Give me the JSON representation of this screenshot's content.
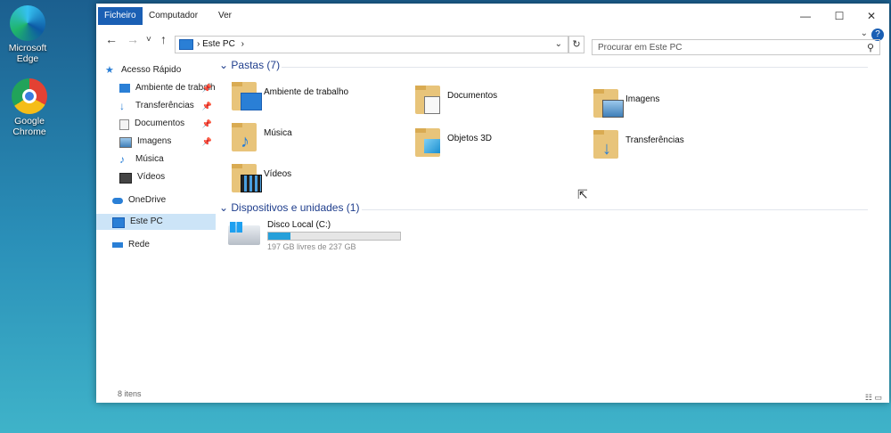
{
  "desktop": {
    "icons": [
      {
        "label": "Microsoft Edge"
      },
      {
        "label": "Google Chrome"
      }
    ]
  },
  "ribbon": {
    "tabs": [
      "Ficheiro",
      "Computador",
      "Ver"
    ]
  },
  "window_controls": {
    "minimize": "—",
    "maximize": "☐",
    "close": "✕"
  },
  "nav": {
    "back": "←",
    "forward": "→",
    "recent": "˅",
    "up": "↑",
    "address": "Este PC",
    "address_sep": "›",
    "refresh": "↻",
    "search_placeholder": "Procurar em Este PC"
  },
  "sidebar": {
    "items": [
      {
        "label": "Acesso Rápido",
        "icon": "star-icon",
        "pinned": false
      },
      {
        "label": "Ambiente de trabalho",
        "icon": "desktop-icon",
        "pinned": true
      },
      {
        "label": "Transferências",
        "icon": "download-icon",
        "pinned": true
      },
      {
        "label": "Documentos",
        "icon": "document-icon",
        "pinned": true
      },
      {
        "label": "Imagens",
        "icon": "picture-icon",
        "pinned": true
      },
      {
        "label": "Música",
        "icon": "music-icon",
        "pinned": false
      },
      {
        "label": "Vídeos",
        "icon": "video-icon",
        "pinned": false
      },
      {
        "label": "OneDrive",
        "icon": "cloud-icon",
        "pinned": false
      },
      {
        "label": "Este PC",
        "icon": "pc-icon",
        "pinned": false
      },
      {
        "label": "Rede",
        "icon": "network-icon",
        "pinned": false
      }
    ]
  },
  "content": {
    "folders_header": "Pastas (7)",
    "folders": [
      {
        "label": "Ambiente de trabalho",
        "icon": "desktop-folder-icon"
      },
      {
        "label": "Documentos",
        "icon": "documents-folder-icon"
      },
      {
        "label": "Imagens",
        "icon": "pictures-folder-icon"
      },
      {
        "label": "Música",
        "icon": "music-folder-icon"
      },
      {
        "label": "Objetos 3D",
        "icon": "3d-objects-folder-icon"
      },
      {
        "label": "Transferências",
        "icon": "downloads-folder-icon"
      },
      {
        "label": "Vídeos",
        "icon": "videos-folder-icon"
      }
    ],
    "devices_header": "Dispositivos e unidades (1)",
    "drive": {
      "name": "Disco Local (C:)",
      "info": "197 GB livres de 237 GB",
      "used_fraction": 0.17
    }
  },
  "status": {
    "items": "8 itens"
  },
  "colors": {
    "accent": "#1a5fb4",
    "folder": "#e8c47a",
    "selected": "#cce4f7",
    "drive_bar": "#26a0da"
  }
}
